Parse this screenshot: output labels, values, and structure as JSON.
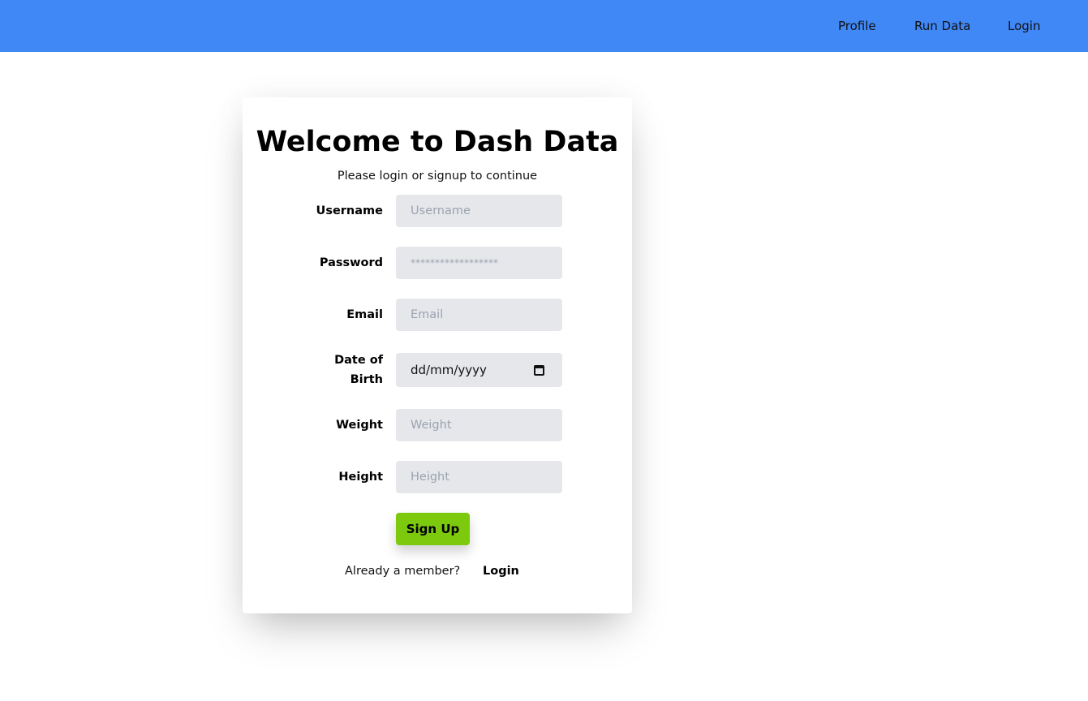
{
  "nav": {
    "items": [
      {
        "label": "Profile"
      },
      {
        "label": "Run Data"
      },
      {
        "label": "Login"
      }
    ],
    "background_color": "#4088f6"
  },
  "card": {
    "title": "Welcome to Dash Data",
    "subtitle": "Please login or signup to continue",
    "fields": {
      "username": {
        "label": "Username",
        "placeholder": "Username",
        "value": ""
      },
      "password": {
        "label": "Password",
        "placeholder": "******************",
        "value": ""
      },
      "email": {
        "label": "Email",
        "placeholder": "Email",
        "value": ""
      },
      "dob": {
        "label_line1": "Date of",
        "label_line2": "Birth",
        "placeholder": "dd/mm/yyyy",
        "icon": "calendar-icon"
      },
      "weight": {
        "label": "Weight",
        "placeholder": "Weight",
        "value": ""
      },
      "height": {
        "label": "Height",
        "placeholder": "Height",
        "value": ""
      }
    },
    "signup_button": {
      "label": "Sign Up",
      "color": "#7cc90d"
    },
    "member_prompt": "Already a member?",
    "member_login": "Login"
  }
}
